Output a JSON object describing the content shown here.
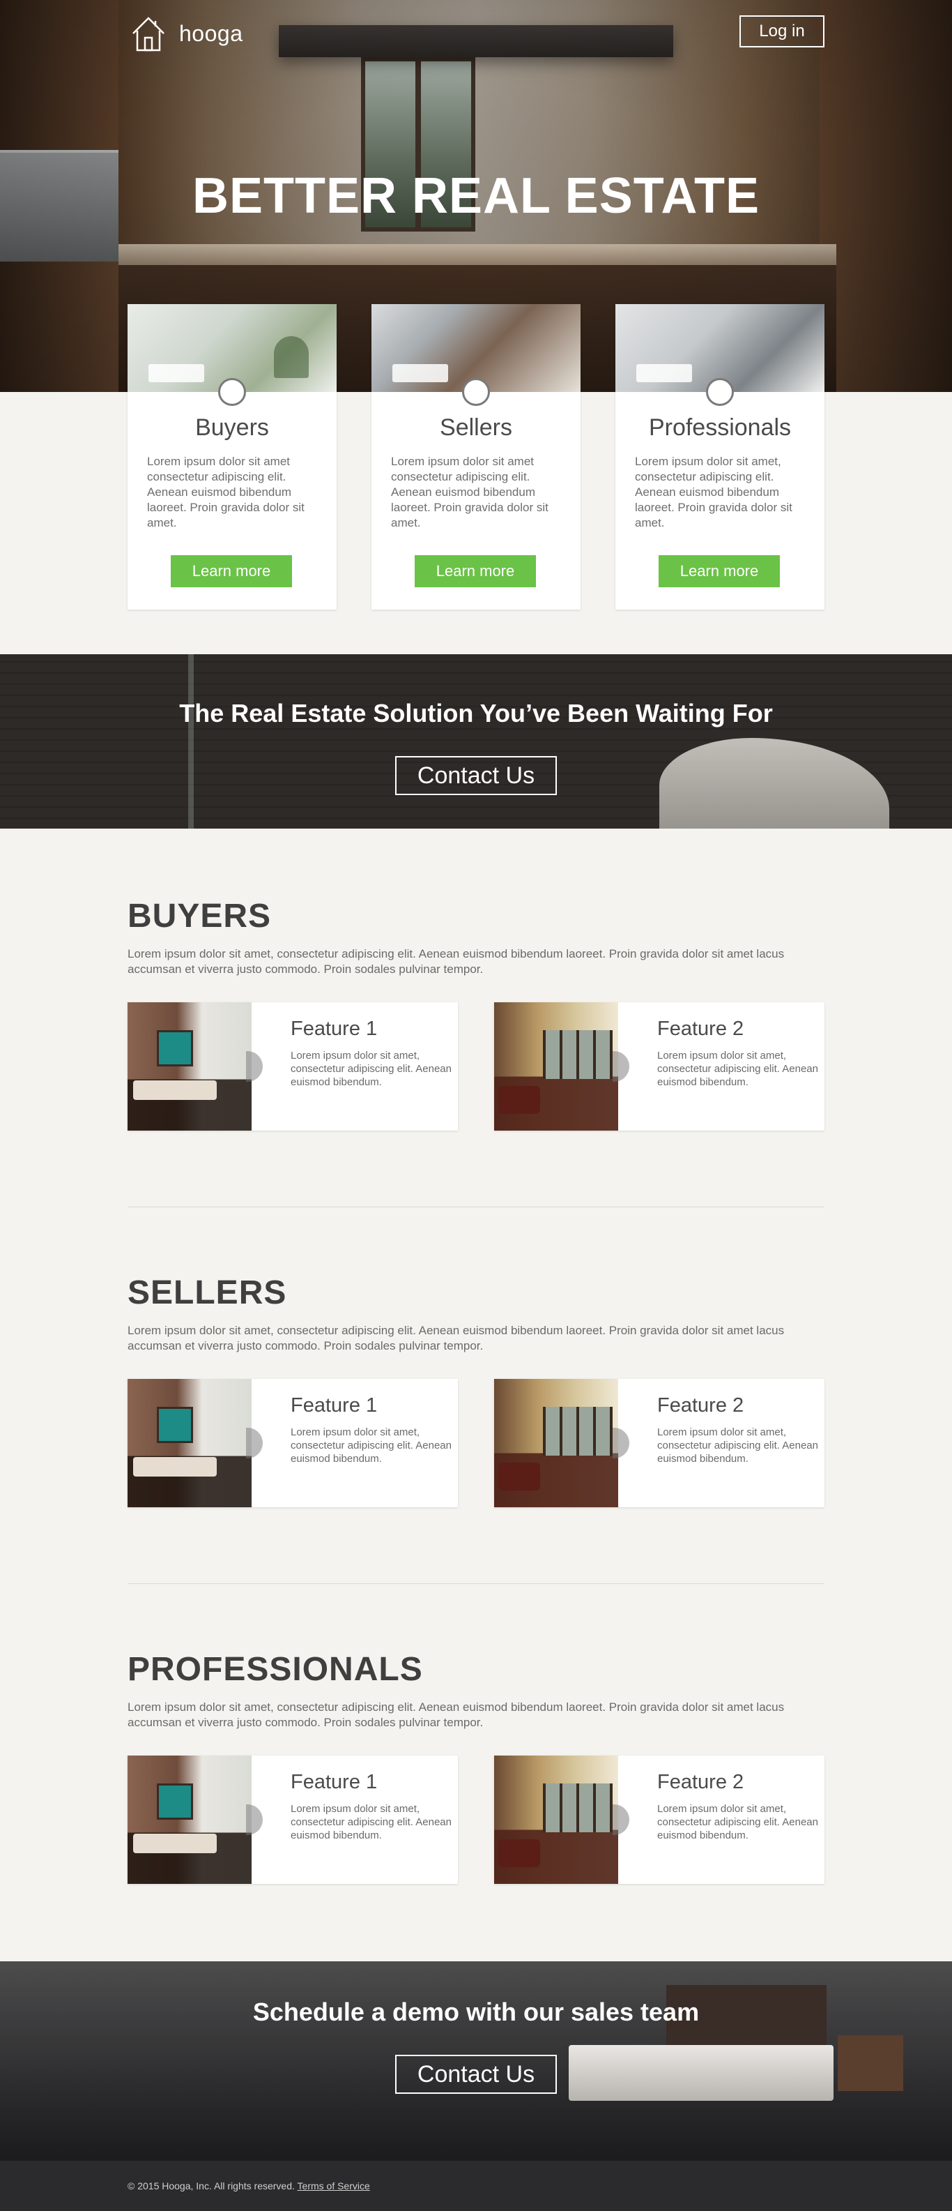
{
  "header": {
    "brand": "hooga",
    "login_label": "Log in",
    "hero_title": "BETTER REAL ESTATE"
  },
  "audience_cards": [
    {
      "title": "Buyers",
      "body": "Lorem ipsum dolor sit amet consectetur adipiscing elit. Aenean euismod bibendum laoreet. Proin gravida dolor sit amet.",
      "button": "Learn more"
    },
    {
      "title": "Sellers",
      "body": "Lorem ipsum dolor sit amet consectetur adipiscing elit. Aenean euismod bibendum laoreet. Proin gravida dolor sit amet.",
      "button": "Learn more"
    },
    {
      "title": "Professionals",
      "body": "Lorem ipsum dolor sit amet, consectetur adipiscing elit. Aenean euismod bibendum laoreet. Proin gravida dolor sit amet.",
      "button": "Learn more"
    }
  ],
  "banner": {
    "headline": "The Real Estate Solution You’ve Been Waiting For",
    "button": "Contact Us"
  },
  "sections": [
    {
      "title": "BUYERS",
      "lead": "Lorem ipsum dolor sit amet, consectetur adipiscing elit. Aenean euismod bibendum laoreet. Proin gravida dolor sit amet lacus accumsan et viverra justo commodo. Proin sodales pulvinar tempor.",
      "features": [
        {
          "title": "Feature 1",
          "body": "Lorem ipsum dolor sit amet, consectetur adipiscing elit. Aenean euismod bibendum."
        },
        {
          "title": "Feature 2",
          "body": "Lorem ipsum dolor sit amet, consectetur adipiscing elit. Aenean euismod bibendum."
        }
      ]
    },
    {
      "title": "SELLERS",
      "lead": "Lorem ipsum dolor sit amet, consectetur adipiscing elit. Aenean euismod bibendum laoreet. Proin gravida dolor sit amet lacus accumsan et viverra justo commodo. Proin sodales pulvinar tempor.",
      "features": [
        {
          "title": "Feature 1",
          "body": "Lorem ipsum dolor sit amet, consectetur adipiscing elit. Aenean euismod bibendum."
        },
        {
          "title": "Feature 2",
          "body": "Lorem ipsum dolor sit amet, consectetur adipiscing elit. Aenean euismod bibendum."
        }
      ]
    },
    {
      "title": "PROFESSIONALS",
      "lead": "Lorem ipsum dolor sit amet, consectetur adipiscing elit. Aenean euismod bibendum laoreet. Proin gravida dolor sit amet lacus accumsan et viverra justo commodo. Proin sodales pulvinar tempor.",
      "features": [
        {
          "title": "Feature 1",
          "body": "Lorem ipsum dolor sit amet, consectetur adipiscing elit. Aenean euismod bibendum."
        },
        {
          "title": "Feature 2",
          "body": "Lorem ipsum dolor sit amet, consectetur adipiscing elit. Aenean euismod bibendum."
        }
      ]
    }
  ],
  "demo": {
    "headline": "Schedule a demo with our sales team",
    "button": "Contact Us"
  },
  "footer": {
    "copyright": "© 2015 Hooga, Inc. All rights reserved.",
    "terms_link": "Terms of Service"
  },
  "colors": {
    "accent_green": "#6ac247",
    "page_background": "#f4f3ef",
    "footer_background": "#2b2b2d"
  },
  "icons": {
    "logo": "house-icon"
  }
}
